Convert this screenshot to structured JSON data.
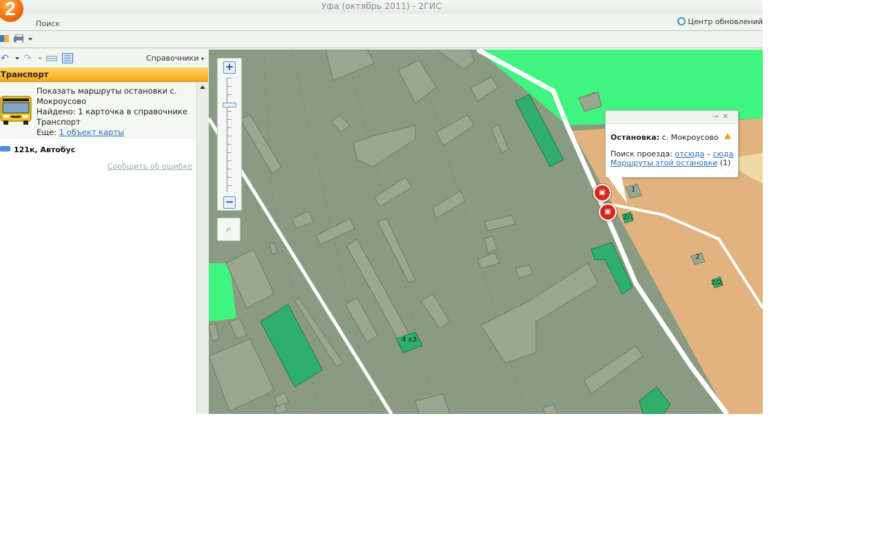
{
  "window": {
    "title": "Уфа (октябрь 2011) - 2ГИС",
    "logo": "2"
  },
  "menu": {
    "search_label": "Поиск",
    "update_center_label": "Центр обновлений"
  },
  "toolbar": {
    "icons": [
      "book-icon",
      "print-icon"
    ]
  },
  "leftpanel": {
    "directories_label": "Справочники",
    "category": "Транспорт",
    "result_card": {
      "line1": "Показать маршруты остановки с. Мокроусово",
      "found_prefix": "Найдено: ",
      "found_text": "1 карточка в справочнике Транспорт",
      "more_prefix": "Еще: ",
      "more_link": "1 объект карты"
    },
    "route": "121к, Автобус",
    "report_error": "Сообщить об ошибке"
  },
  "map": {
    "popup": {
      "title_bold": "Остановка:",
      "title_value": " с. Мокроусово",
      "search_prefix": "Поиск проезда: ",
      "from_here": "отсюда",
      "dash": " – ",
      "to_here": "сюда",
      "routes_link": "Маршруты этой остановки",
      "routes_count": " (1)"
    },
    "building_labels": {
      "b1": "1",
      "b21": "2/1",
      "b2": "2",
      "b22": "2/2",
      "b4k3": "4 к3"
    },
    "colors": {
      "ground": "#8b9a83",
      "green": "#3ff57f",
      "sand": "#e2b37e",
      "building": "#9aa68f",
      "building_green": "#2fae6c",
      "road": "#ffffff"
    }
  }
}
